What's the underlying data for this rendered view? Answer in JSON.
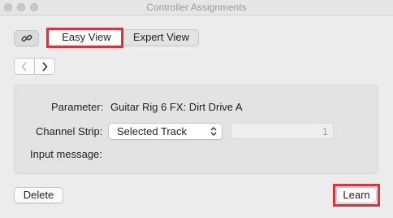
{
  "window": {
    "title": "Controller Assignments"
  },
  "toolbar": {
    "link_icon": "link-icon",
    "view_tabs": [
      {
        "label": "Easy View",
        "selected": true
      },
      {
        "label": "Expert View",
        "selected": false
      }
    ],
    "nav_prev_icon": "chevron-left-icon",
    "nav_next_icon": "chevron-right-icon"
  },
  "assignment": {
    "parameter_label": "Parameter:",
    "parameter_value": "Guitar Rig 6 FX: Dirt Drive A",
    "channel_strip_label": "Channel Strip:",
    "channel_strip_value": "Selected Track",
    "channel_field_value": "1",
    "input_message_label": "Input message:"
  },
  "footer": {
    "delete_label": "Delete",
    "learn_label": "Learn"
  },
  "colors": {
    "highlight": "#e0303a",
    "window_bg": "#ececec",
    "panel_bg": "#e3e3e3"
  }
}
